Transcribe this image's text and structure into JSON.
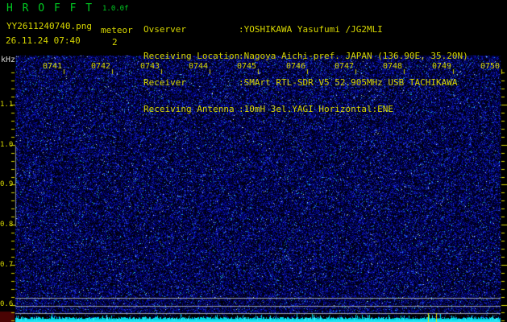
{
  "header": {
    "app_title": "H R O F F T",
    "version": "1.0.0f",
    "filename": "YY2611240740.png",
    "mode_label": "meteor",
    "event_count": "2",
    "datetime": "26.11.24 07:40",
    "info_rows": [
      {
        "label": "Ovserver",
        "value": ":YOSHIKAWA Yasufumi /JG2MLI"
      },
      {
        "label": "Receiving Location",
        "value": ":Nagoya Aichi-pref. JAPAN (136.90E, 35.20N)"
      },
      {
        "label": "Receiver",
        "value": ":SMArt RTL-SDR V5 52.905MHz USB TACHIKAWA"
      },
      {
        "label": "Receiving Antenna",
        "value": ":10mH 3el.YAGI Horizontal:ENE"
      }
    ]
  },
  "spectrogram": {
    "unit_label": "kHz",
    "time_labels": [
      "0741",
      "0742",
      "0743",
      "0744",
      "0745",
      "0746",
      "0747",
      "0748",
      "0749",
      "0750"
    ],
    "freq_labels": [
      "1.1",
      "1.0",
      "0.9",
      "0.8",
      "0.7",
      "0.6"
    ],
    "event_marker_count": 2,
    "event_marker_xs": [
      531,
      541
    ],
    "colors": {
      "title_green": "#00cc22",
      "text_yellow": "#d6d600",
      "unit_white": "#d8d8d8",
      "grid_gray": "#99a2ac",
      "level_cyan": "#00d8e8",
      "marker_yellow": "#eded00",
      "corner_red": "#4a0404"
    }
  }
}
